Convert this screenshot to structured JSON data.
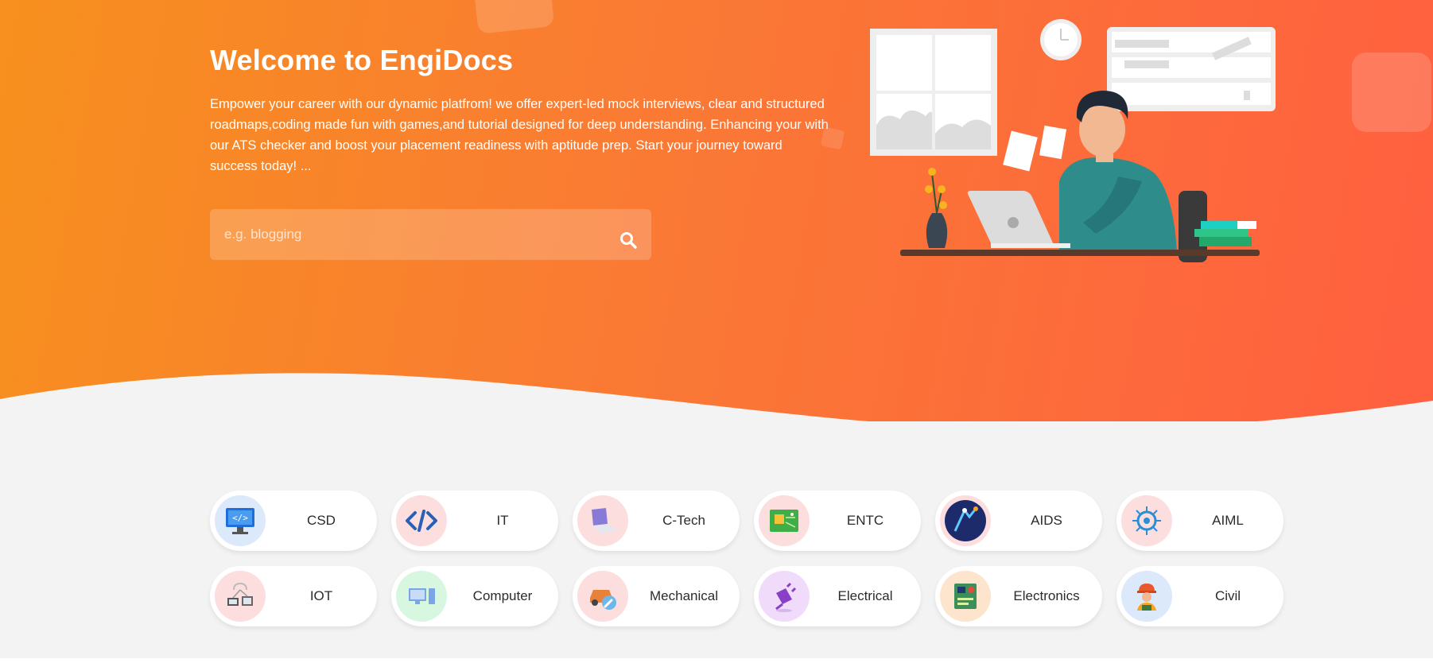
{
  "hero": {
    "title": "Welcome to EngiDocs",
    "description": "Empower your career with our dynamic platfrom! we offer expert-led mock interviews, clear and structured roadmaps,coding made fun with games,and tutorial designed for deep understanding. Enhancing your with our ATS checker and boost your placement readiness with aptitude prep. Start your journey toward success today! ...",
    "gradient_start": "#f7901e",
    "gradient_end": "#ff5f40"
  },
  "search": {
    "placeholder": "e.g. blogging",
    "value": "",
    "icon": "search-icon"
  },
  "categories": {
    "row1": [
      {
        "label": "CSD",
        "icon": "computer-code-icon"
      },
      {
        "label": "IT",
        "icon": "code-brackets-icon"
      },
      {
        "label": "C-Tech",
        "icon": "laptop-icon"
      },
      {
        "label": "ENTC",
        "icon": "circuit-board-icon"
      },
      {
        "label": "AIDS",
        "icon": "data-science-icon"
      },
      {
        "label": "AIML",
        "icon": "brain-chip-icon"
      }
    ],
    "row2": [
      {
        "label": "IOT",
        "icon": "connected-devices-icon"
      },
      {
        "label": "Computer",
        "icon": "desktop-computer-icon"
      },
      {
        "label": "Mechanical",
        "icon": "car-wrench-icon"
      },
      {
        "label": "Electrical",
        "icon": "electric-plug-icon"
      },
      {
        "label": "Electronics",
        "icon": "electronic-chip-icon"
      },
      {
        "label": "Civil",
        "icon": "construction-worker-icon"
      }
    ]
  },
  "colors": {
    "page_background": "#f3f3f3",
    "pill_background": "#ffffff",
    "label_text": "#2b2b2b"
  }
}
